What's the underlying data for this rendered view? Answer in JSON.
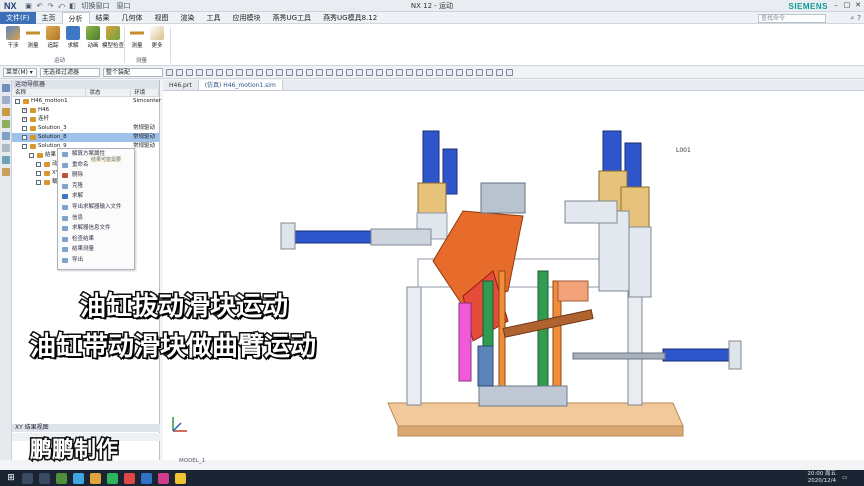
{
  "titlebar": {
    "logo": "NX",
    "title": "NX 12 - 运动",
    "brand": "SIEMENS",
    "quick": [
      "↶",
      "↷",
      "⤺",
      "◧"
    ],
    "switch_window": "切换窗口",
    "window_menu": "窗口"
  },
  "menu": {
    "file": "文件(F)",
    "items": [
      "主页",
      "分析",
      "结果",
      "几何体",
      "视图",
      "渲染",
      "工具",
      "应用模块",
      "燕秀UG工具",
      "燕秀UG模具8.12"
    ],
    "active_index": 1,
    "search_placeholder": "查找命令"
  },
  "ribbon": {
    "groups": [
      {
        "name": "运动",
        "buttons": [
          "干涉",
          "测量",
          "追踪",
          "求解",
          "动画",
          "模型检查"
        ]
      },
      {
        "name": "测量",
        "buttons": [
          "测量",
          "更多"
        ]
      }
    ]
  },
  "selection": {
    "menu_label": "菜单(M) ▾",
    "filter": "无选择过滤器",
    "assembly": "整个装配"
  },
  "navigator": {
    "title": "运动导航器",
    "columns": [
      "名称",
      "状态",
      "环境"
    ],
    "rows": [
      {
        "name": "H46_motion1",
        "env": "Simcenter",
        "indent": 0,
        "selected": false
      },
      {
        "name": "H46",
        "env": "",
        "indent": 1,
        "selected": false
      },
      {
        "name": "连杆",
        "env": "",
        "indent": 1,
        "selected": false
      },
      {
        "name": "Solution_3",
        "env": "常规驱动",
        "indent": 1,
        "selected": false
      },
      {
        "name": "Solution_8",
        "env": "常规驱动",
        "indent": 1,
        "selected": true
      },
      {
        "name": "Solution_9",
        "env": "常规驱动",
        "indent": 1,
        "selected": false
      },
      {
        "name": "结果",
        "env": "",
        "indent": 2,
        "selected": false
      },
      {
        "name": "动画",
        "env": "",
        "indent": 3,
        "selected": false
      },
      {
        "name": "XY",
        "env": "",
        "indent": 3,
        "selected": false
      },
      {
        "name": "载荷",
        "env": "",
        "indent": 3,
        "selected": false
      }
    ],
    "context_menu": [
      "解算方案属性",
      "重命名",
      "删除",
      "克隆",
      "求解",
      "导出求解器输入文件",
      "信息",
      "求解器信息文件",
      "检查结果",
      "结果测量",
      "导出"
    ],
    "tooltip": "结果可能需要",
    "bottom_panel": "XY 结果视图"
  },
  "graphics": {
    "tabs": [
      "H46.prt",
      "(仿真) H46_motion1.sim"
    ],
    "active_tab": 1,
    "label_l001": "L001",
    "model_label": "MODEL_1"
  },
  "captions": {
    "line1": "油缸拔动滑块运动",
    "line2": "油缸带动滑块做曲臂运动",
    "watermark": "鹏鹏制作"
  },
  "taskbar": {
    "time": "20:00 周五",
    "date": "2020/12/4"
  }
}
